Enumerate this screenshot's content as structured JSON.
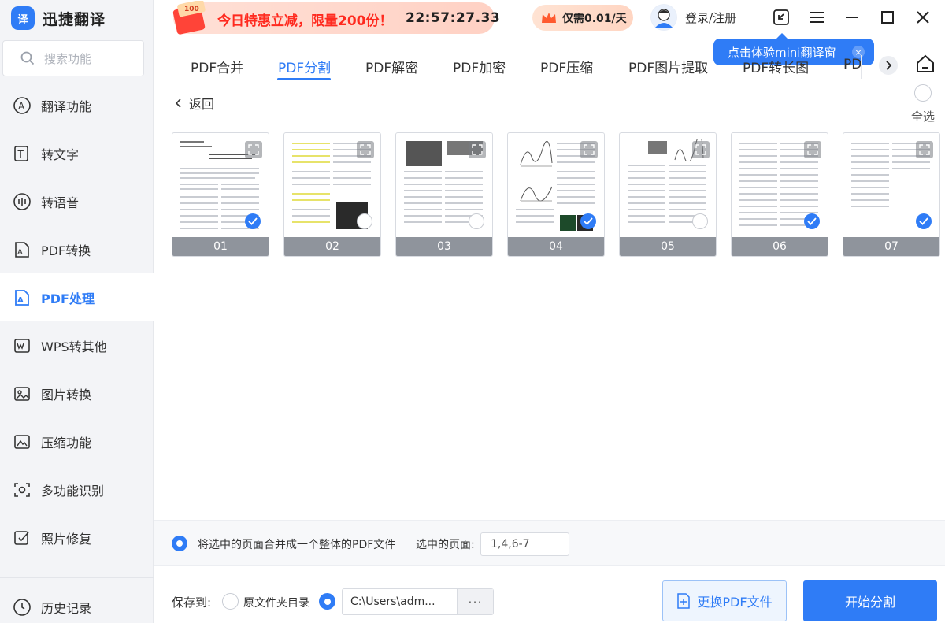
{
  "app": {
    "title": "迅捷翻译",
    "logo_badge": "译"
  },
  "search": {
    "placeholder": "搜索功能"
  },
  "sidebar": {
    "items": [
      {
        "label": "翻译功能",
        "icon": "translate-icon"
      },
      {
        "label": "转文字",
        "icon": "text-convert-icon"
      },
      {
        "label": "转语音",
        "icon": "voice-icon"
      },
      {
        "label": "PDF转换",
        "icon": "pdf-convert-icon"
      },
      {
        "label": "PDF处理",
        "icon": "pdf-process-icon",
        "active": true
      },
      {
        "label": "WPS转其他",
        "icon": "wps-icon"
      },
      {
        "label": "图片转换",
        "icon": "image-convert-icon"
      },
      {
        "label": "压缩功能",
        "icon": "compress-icon"
      },
      {
        "label": "多功能识别",
        "icon": "recognize-icon"
      },
      {
        "label": "照片修复",
        "icon": "photo-repair-icon"
      }
    ],
    "history": "历史记录"
  },
  "promo": {
    "badge": "100",
    "text": "今日特惠立减，限量200份！",
    "countdown": "22:57:27.33"
  },
  "price": {
    "text": "仅需0.01/天"
  },
  "user": {
    "login_label": "登录/注册"
  },
  "tooltip": {
    "text": "点击体验mini翻译窗",
    "close": "×"
  },
  "tabs": [
    {
      "label": "PDF合并"
    },
    {
      "label": "PDF分割",
      "active": true
    },
    {
      "label": "PDF解密"
    },
    {
      "label": "PDF加密"
    },
    {
      "label": "PDF压缩"
    },
    {
      "label": "PDF图片提取"
    },
    {
      "label": "PDF转长图"
    },
    {
      "label": "PD"
    }
  ],
  "back": {
    "label": "返回"
  },
  "select_all": {
    "label": "全选"
  },
  "pages": [
    {
      "num": "01",
      "selected": true
    },
    {
      "num": "02",
      "selected": false
    },
    {
      "num": "03",
      "selected": false
    },
    {
      "num": "04",
      "selected": true
    },
    {
      "num": "05",
      "selected": false
    },
    {
      "num": "06",
      "selected": true
    },
    {
      "num": "07",
      "selected": true
    }
  ],
  "options": {
    "merge_text": "将选中的页面合并成一个整体的PDF文件",
    "selected_label": "选中的页面:",
    "selected_value": "1,4,6-7"
  },
  "save": {
    "label": "保存到:",
    "original_dir": "原文件夹目录",
    "path": "C:\\Users\\adm...",
    "more": "···"
  },
  "buttons": {
    "change_file": "更换PDF文件",
    "start": "开始分割"
  },
  "colors": {
    "accent": "#2f7cf6",
    "promo_red": "#ff2a1f"
  }
}
